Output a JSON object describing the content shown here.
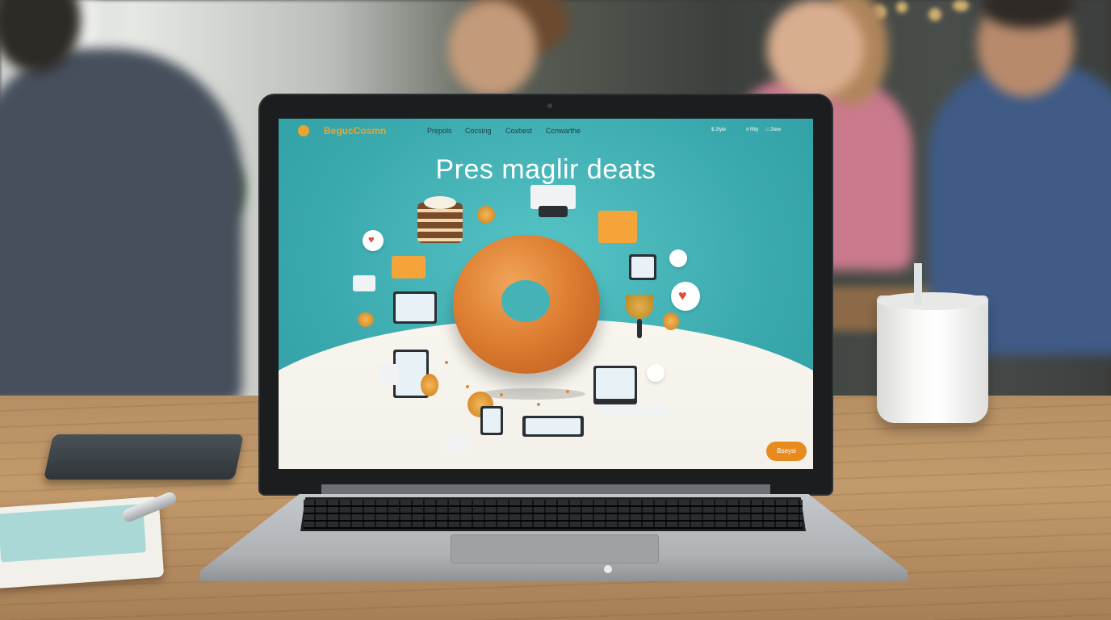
{
  "website": {
    "brand": "BegucCosmn",
    "nav_links": [
      "Prepols",
      "Cocsing",
      "Coxbest",
      "Ccnwarthe"
    ],
    "nav_utilities": [
      "$ 2fyte",
      "# Rtly",
      "□ 2tew"
    ],
    "headline": "Pres maglir deats",
    "cta_label": "Bseysi"
  },
  "colors": {
    "teal_background": "#3fb0b4",
    "brand_orange": "#e9a42f",
    "cta_orange": "#e88b1f",
    "donut": "#de7f32"
  }
}
